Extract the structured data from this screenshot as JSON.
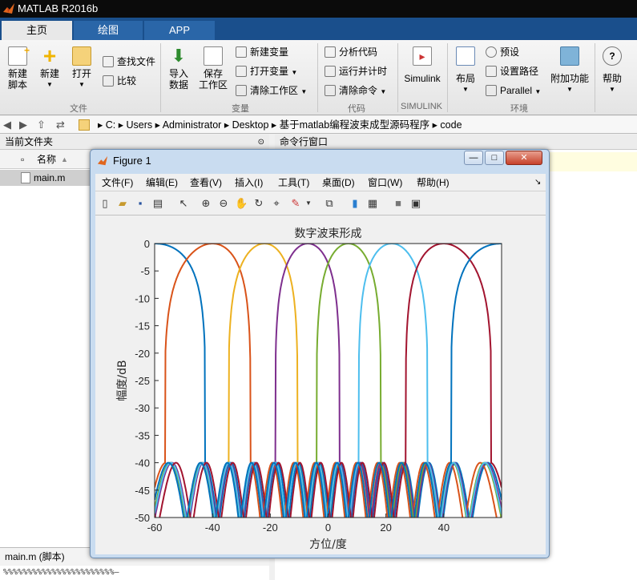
{
  "app": {
    "title": "MATLAB R2016b"
  },
  "tabs": [
    "主页",
    "绘图",
    "APP"
  ],
  "ribbon": {
    "file": {
      "new_script": "新建\n脚本",
      "new": "新建",
      "open": "打开",
      "find_files": "查找文件",
      "compare": "比较",
      "section": "文件"
    },
    "variable": {
      "import": "导入\n数据",
      "save_ws": "保存\n工作区",
      "new_var": "新建变量",
      "open_var": "打开变量",
      "clear_ws": "清除工作区",
      "section": "变量"
    },
    "code": {
      "analyze": "分析代码",
      "run_time": "运行并计时",
      "clear_cmd": "清除命令",
      "section": "代码"
    },
    "simulink": {
      "label": "Simulink",
      "section": "SIMULINK"
    },
    "env": {
      "layout": "布局",
      "prefs": "预设",
      "set_path": "设置路径",
      "parallel": "Parallel",
      "addons": "附加功能",
      "section": "环境"
    },
    "help": {
      "label": "帮助"
    }
  },
  "address": [
    "C:",
    "Users",
    "Administrator",
    "Desktop",
    "基于matlab编程波束成型源码程序",
    "code"
  ],
  "current_folder": {
    "title": "当前文件夹",
    "col_name": "名称",
    "files": [
      "main.m"
    ],
    "detail": "main.m  (脚本)",
    "detail_code": "%%%%%%%%%%%%%%%%%%%%%%%—"
  },
  "command_window": {
    "title": "命令行窗口"
  },
  "figure": {
    "title": "Figure 1",
    "menu": [
      "文件(F)",
      "编辑(E)",
      "查看(V)",
      "插入(I)",
      "工具(T)",
      "桌面(D)",
      "窗口(W)",
      "帮助(H)"
    ],
    "min_label": "—",
    "max_label": "□",
    "close_label": "✕"
  },
  "colors": {
    "tab_active": "#e8e8e8",
    "tabbar": "#1a4f8c"
  },
  "chart_data": {
    "type": "line",
    "title": "数字波束形成",
    "xlabel": "方位/度",
    "ylabel": "幅度/dB",
    "xlim": [
      -60,
      60
    ],
    "ylim": [
      -50,
      0
    ],
    "xticks": [
      -60,
      -40,
      -20,
      0,
      20,
      40
    ],
    "yticks": [
      0,
      -5,
      -10,
      -15,
      -20,
      -25,
      -30,
      -35,
      -40,
      -45,
      -50
    ],
    "sidelobe_floor_db": -40,
    "series": [
      {
        "steer_deg": -60,
        "color": "#0072BD"
      },
      {
        "steer_deg": -40,
        "color": "#D95319"
      },
      {
        "steer_deg": -22,
        "color": "#EDB120"
      },
      {
        "steer_deg": -7,
        "color": "#7E2F8E"
      },
      {
        "steer_deg": 7,
        "color": "#77AC30"
      },
      {
        "steer_deg": 22,
        "color": "#4DBEEE"
      },
      {
        "steer_deg": 40,
        "color": "#A2142F"
      },
      {
        "steer_deg": 60,
        "color": "#0072BD"
      }
    ]
  }
}
